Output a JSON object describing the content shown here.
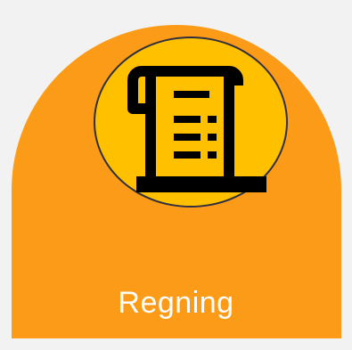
{
  "tile": {
    "label": "Regning",
    "icon": "receipt-scroll-icon",
    "colors": {
      "tile_background": "#fc9b17",
      "icon_circle": "#ffc000",
      "icon_stroke": "#000000",
      "label_text": "#ffffff",
      "page_background": "#f2f2f2"
    }
  }
}
